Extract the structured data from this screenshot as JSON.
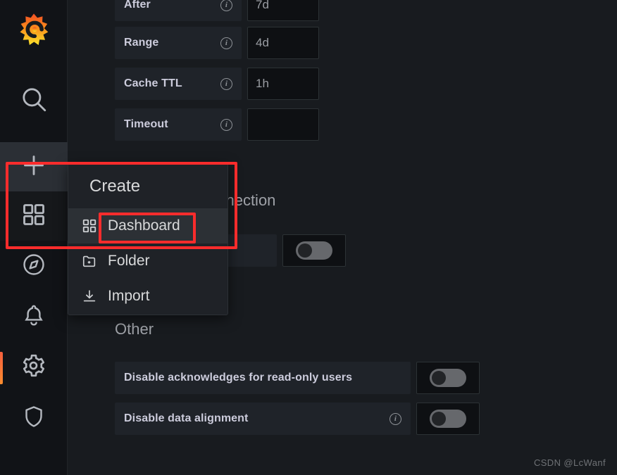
{
  "app": {
    "name": "Grafana",
    "watermark": "CSDN @LcWanf"
  },
  "sidebar": {
    "items": [
      {
        "name": "logo",
        "icon": "grafana-logo-icon",
        "label": "Grafana"
      },
      {
        "name": "search",
        "icon": "search-icon",
        "label": "Search"
      },
      {
        "name": "create",
        "icon": "plus-icon",
        "label": "Create"
      },
      {
        "name": "dashboards",
        "icon": "dashboards-grid-icon",
        "label": "Dashboards"
      },
      {
        "name": "explore",
        "icon": "compass-icon",
        "label": "Explore"
      },
      {
        "name": "alerting",
        "icon": "bell-icon",
        "label": "Alerting"
      },
      {
        "name": "configuration",
        "icon": "gear-icon",
        "label": "Configuration"
      },
      {
        "name": "server-admin",
        "icon": "shield-icon",
        "label": "Server Admin"
      }
    ]
  },
  "create_menu": {
    "title": "Create",
    "items": [
      {
        "label": "Dashboard",
        "icon": "dashboards-grid-icon",
        "highlighted": true
      },
      {
        "label": "Folder",
        "icon": "folder-plus-icon",
        "highlighted": false
      },
      {
        "label": "Import",
        "icon": "import-download-icon",
        "highlighted": false
      }
    ]
  },
  "form": {
    "fields": [
      {
        "label": "After",
        "value": "7d",
        "info": true
      },
      {
        "label": "Range",
        "value": "4d",
        "info": true
      },
      {
        "label": "Cache TTL",
        "value": "1h",
        "info": true
      },
      {
        "label": "Timeout",
        "value": "",
        "info": true
      }
    ],
    "connection_section": {
      "heading_visible_text": "onnection"
    },
    "connection_toggle": {
      "state": "off"
    },
    "other_section": {
      "heading": "Other",
      "rows": [
        {
          "label": "Disable acknowledges for read-only users",
          "info": false,
          "state": "off"
        },
        {
          "label": "Disable data alignment",
          "info": true,
          "state": "off"
        }
      ]
    }
  },
  "colors": {
    "accent_orange": "#fb8c2e",
    "annotation_red": "#fb2c2c",
    "page_bg": "#181b1f",
    "panel_bg": "#1f2329",
    "text_primary": "#ccccdc"
  }
}
